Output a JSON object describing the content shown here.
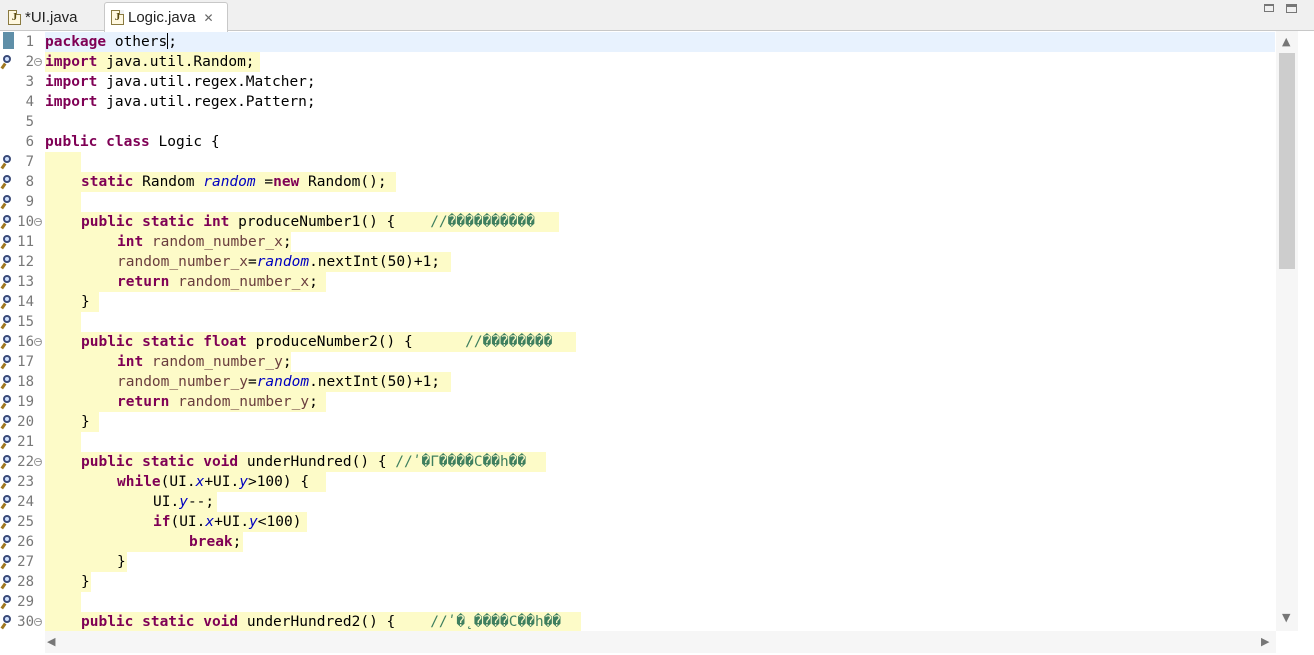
{
  "tabs": [
    {
      "label": "*UI.java",
      "active": false
    },
    {
      "label": "Logic.java",
      "active": true
    }
  ],
  "colors": {
    "keyword": "#7f0055",
    "field": "#0000c0",
    "local_variable": "#6a3e3e",
    "comment": "#3f7f5f",
    "occurrence_highlight": "#fdfbc8",
    "current_line": "#e8f2fe"
  },
  "editor": {
    "file": "Logic.java",
    "lines": [
      {
        "n": "1"
      },
      {
        "n": "2",
        "fold": true
      },
      {
        "n": "3"
      },
      {
        "n": "4"
      },
      {
        "n": "5"
      },
      {
        "n": "6"
      },
      {
        "n": "7"
      },
      {
        "n": "8"
      },
      {
        "n": "9"
      },
      {
        "n": "10",
        "fold": true
      },
      {
        "n": "11"
      },
      {
        "n": "12"
      },
      {
        "n": "13"
      },
      {
        "n": "14"
      },
      {
        "n": "15"
      },
      {
        "n": "16",
        "fold": true
      },
      {
        "n": "17"
      },
      {
        "n": "18"
      },
      {
        "n": "19"
      },
      {
        "n": "20"
      },
      {
        "n": "21"
      },
      {
        "n": "22",
        "fold": true
      },
      {
        "n": "23"
      },
      {
        "n": "24"
      },
      {
        "n": "25"
      },
      {
        "n": "26"
      },
      {
        "n": "27"
      },
      {
        "n": "28"
      },
      {
        "n": "29"
      },
      {
        "n": "30",
        "fold": true
      }
    ],
    "code": {
      "l1_kw": "package",
      "l1_pkg": " others",
      "l1_semi": ";",
      "l2_kw": "import",
      "l2_rest": " java.util.Random;",
      "l3_kw": "import",
      "l3_rest": " java.util.regex.Matcher;",
      "l4_kw": "import",
      "l4_rest": " java.util.regex.Pattern;",
      "l6_kw1": "public",
      "l6_kw2": "class",
      "l6_rest": " Logic {",
      "l8_kw": "static",
      "l8_type": " Random ",
      "l8_field": "random",
      "l8_eq": " =",
      "l8_new": "new",
      "l8_rest": " Random();",
      "l10_kw": "public static int",
      "l10_rest": " produceNumber1() {    ",
      "l10_cmt": "//����������",
      "l11_kw": "int",
      "l11_local": " random_number_x",
      "l11_semi": ";",
      "l12_local": "random_number_x",
      "l12_eq": "=",
      "l12_field": "random",
      "l12_rest": ".nextInt(50)+1;",
      "l13_kw": "return",
      "l13_local": " random_number_x",
      "l13_semi": ";",
      "l14": "}",
      "l16_kw": "public static float",
      "l16_rest": " produceNumber2() {      ",
      "l16_cmt": "//��������",
      "l17_kw": "int",
      "l17_local": " random_number_y",
      "l17_semi": ";",
      "l18_local": "random_number_y",
      "l18_eq": "=",
      "l18_field": "random",
      "l18_rest": ".nextInt(50)+1;",
      "l19_kw": "return",
      "l19_local": " random_number_y",
      "l19_semi": ";",
      "l20": "}",
      "l22_kw": "public static void",
      "l22_rest": " underHundred() { ",
      "l22_cmt": "//ʹ�Γ����С��հ��",
      "l23_kw": "while",
      "l23_a": "(UI.",
      "l23_x": "x",
      "l23_b": "+UI.",
      "l23_y": "y",
      "l23_c": ">100) {",
      "l24_a": "UI.",
      "l24_y": "y",
      "l24_b": "--;",
      "l25_kw": "if",
      "l25_a": "(UI.",
      "l25_x": "x",
      "l25_b": "+UI.",
      "l25_y": "y",
      "l25_c": "<100)",
      "l26_kw": "break",
      "l26_semi": ";",
      "l27": "}",
      "l28": "}",
      "l30_kw": "public static void",
      "l30_rest": " underHundred2() {    ",
      "l30_cmt": "//ʹ�˛����С��հ��"
    }
  },
  "icons": [
    "java-file-icon",
    "close-icon",
    "minimize-icon",
    "maximize-icon",
    "search-occurrence-icon",
    "fold-icon",
    "arrow-up-icon",
    "arrow-down-icon",
    "arrow-left-icon",
    "arrow-right-icon"
  ]
}
